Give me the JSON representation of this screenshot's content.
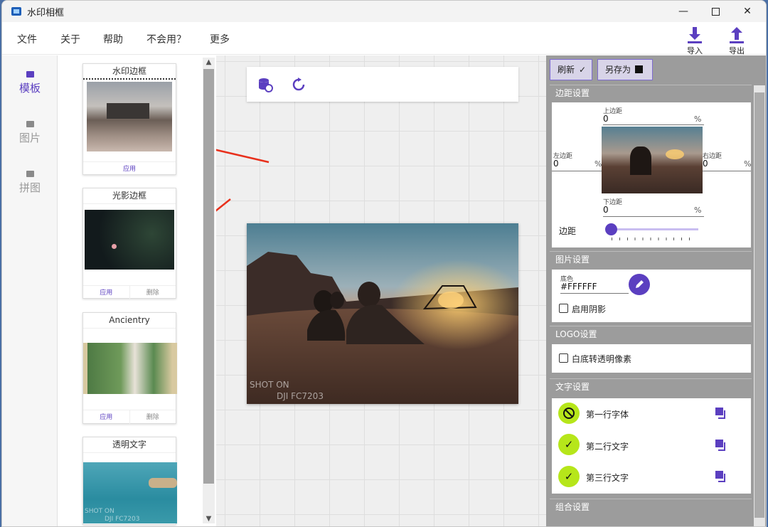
{
  "window": {
    "title": "水印相框",
    "min": "—",
    "max": "☐",
    "close": "✕"
  },
  "menu": [
    "文件",
    "关于",
    "帮助",
    "不会用？",
    "更多"
  ],
  "io": {
    "import": "导入",
    "export": "导出"
  },
  "nav": [
    {
      "label": "模板",
      "icon": "grid-icon"
    },
    {
      "label": "图片",
      "icon": "folder-icon"
    },
    {
      "label": "拼图",
      "icon": "image-icon"
    }
  ],
  "templates": [
    {
      "title": "水印边框",
      "actions": [
        "应用"
      ]
    },
    {
      "title": "光影边框",
      "actions": [
        "应用",
        "删除"
      ]
    },
    {
      "title": "Ancientry",
      "actions": [
        "应用",
        "删除"
      ]
    },
    {
      "title": "透明文字",
      "actions": []
    }
  ],
  "thumb_text": {
    "shot_on": "SHOT ON",
    "model": "DJI FC7203"
  },
  "photo_watermark": {
    "shot_on": "SHOT ON",
    "model": "DJI FC7203"
  },
  "right": {
    "refresh": "刷新",
    "save_as": "另存为",
    "margin": {
      "header": "边距设置",
      "top_label": "上边距",
      "top_value": "0",
      "left_label": "左边距",
      "left_value": "0",
      "right_label": "右边距",
      "right_value": "0",
      "bottom_label": "下边距",
      "bottom_value": "0",
      "unit": "%",
      "slider_label": "边距",
      "slider_value": 0
    },
    "image": {
      "header": "图片设置",
      "color_label": "底色",
      "color_value": "#FFFFFF",
      "shadow_label": "启用阴影"
    },
    "logo": {
      "header": "LOGO设置",
      "transparent_label": "白底转透明像素"
    },
    "text": {
      "header": "文字设置",
      "rows": [
        {
          "label": "第一行字体",
          "state": "disabled"
        },
        {
          "label": "第二行文字",
          "state": "enabled"
        },
        {
          "label": "第三行文字",
          "state": "enabled"
        }
      ]
    },
    "combo": {
      "header": "组合设置"
    }
  },
  "colors": {
    "accent": "#5b3fc0",
    "check": "#b6e61a",
    "arrow": "#e8301c"
  }
}
